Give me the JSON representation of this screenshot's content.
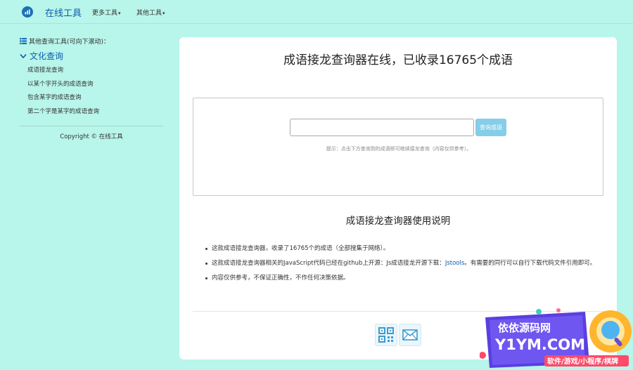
{
  "nav": {
    "brand": "在线工具",
    "menus": [
      {
        "label": "更多工具"
      },
      {
        "label": "其他工具"
      }
    ]
  },
  "sidebar": {
    "heading": "其他查询工具(可向下滚动)：",
    "category": "文化查询",
    "links": [
      "成语接龙查询",
      "以某个字开头的成语查询",
      "包含某字的成语查询",
      "第二个字是某字的成语查询"
    ],
    "copyright": "Copyright © 在线工具"
  },
  "main": {
    "title": "成语接龙查询器在线，已收录16765个成语",
    "query": {
      "input_value": "",
      "button_label": "查询成语",
      "hint": "提示：点击下方查询到的成语即可继续接龙查询（内容仅供参考）。"
    },
    "usage_title": "成语接龙查询器使用说明",
    "instructions": {
      "item1": "这款成语接龙查询器，收录了16765个的成语（全部搜集于网络）。",
      "item2_before": "这款成语接龙查询器相关的JavaScript代码已经在github上开源：Js成语接龙开源下载：",
      "item2_link": "Jstools",
      "item2_after": "。有需要的同行可以自行下载代码文件引用即可。",
      "item3": "内容仅供参考，不保证正确性，不作任何决策依据。"
    }
  },
  "watermark": {
    "line1": "依依源码网",
    "line2": "Y1YM.COM",
    "line3": "软件/游戏/小程序/棋牌"
  },
  "colors": {
    "background": "#b8f5ea",
    "brand": "#0b5cad",
    "button": "#86cdea"
  }
}
